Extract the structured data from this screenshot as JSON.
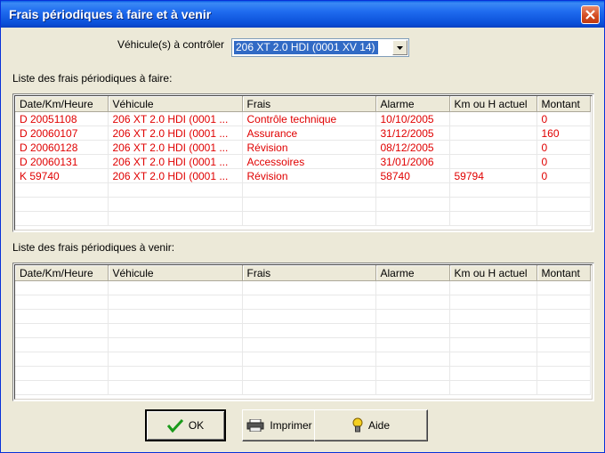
{
  "window": {
    "title": "Frais périodiques à faire et à venir"
  },
  "vehicle_selector": {
    "label": "Véhicule(s) à contrôler",
    "value": "206 XT 2.0 HDI (0001 XV 14)"
  },
  "todo_section": {
    "label": "Liste des frais périodiques à faire:",
    "columns": [
      "Date/Km/Heure",
      "Véhicule",
      "Frais",
      "Alarme",
      "Km ou H actuel",
      "Montant"
    ],
    "rows": [
      [
        "D 20051108",
        "206 XT 2.0 HDI (0001 ...",
        "Contrôle technique",
        "10/10/2005",
        "",
        "0"
      ],
      [
        "D 20060107",
        "206 XT 2.0 HDI (0001 ...",
        "Assurance",
        "31/12/2005",
        "",
        "160"
      ],
      [
        "D 20060128",
        "206 XT 2.0 HDI (0001 ...",
        "Révision",
        "08/12/2005",
        "",
        "0"
      ],
      [
        "D 20060131",
        "206 XT 2.0 HDI (0001 ...",
        "Accessoires",
        "31/01/2006",
        "",
        "0"
      ],
      [
        "K 59740",
        "206 XT 2.0 HDI (0001 ...",
        "Révision",
        "58740",
        "59794",
        "0"
      ]
    ],
    "row_color": "#e00000"
  },
  "upcoming_section": {
    "label": "Liste des frais périodiques à venir:",
    "columns": [
      "Date/Km/Heure",
      "Véhicule",
      "Frais",
      "Alarme",
      "Km ou H actuel",
      "Montant"
    ],
    "rows": []
  },
  "buttons": {
    "ok": {
      "label": "OK",
      "icon": "checkmark-icon"
    },
    "print": {
      "label": "Imprimer",
      "icon": "printer-icon"
    },
    "help": {
      "label": "Aide",
      "icon": "lightbulb-icon"
    }
  }
}
